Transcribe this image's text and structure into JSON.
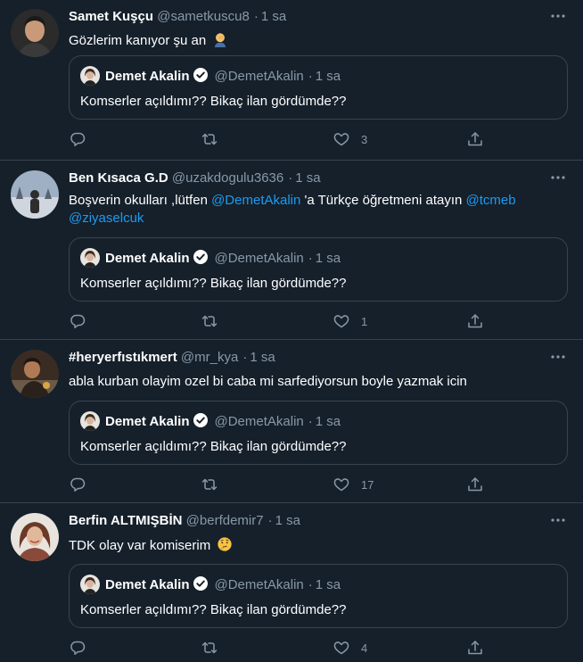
{
  "tweets": [
    {
      "name": "Samet Kuşçu",
      "handle": "@sametkuscu8",
      "time": "1 sa",
      "text_before": "Gözlerim kanıyor şu an",
      "emoji": "facepalm-emoji",
      "likes": "3",
      "quote": {
        "name": "Demet Akalin",
        "handle": "@DemetAkalin",
        "time": "1 sa",
        "text": "Komserler açıldımı?? Bikaç ilan gördümde??"
      }
    },
    {
      "name": "Ben Kısaca G.D",
      "handle": "@uzakdogulu3636",
      "time": "1 sa",
      "text_line1_a": "Boşverin okulları ,lütfen ",
      "mention1": "@DemetAkalin",
      "text_line1_b": " 'a Türkçe öğretmeni atayın ",
      "mention2": "@tcmeb",
      "mention3": "@ziyaselcuk",
      "likes": "1",
      "quote": {
        "name": "Demet Akalin",
        "handle": "@DemetAkalin",
        "time": "1 sa",
        "text": "Komserler açıldımı?? Bikaç ilan gördümde??"
      }
    },
    {
      "name": "#heryerfıstıkmert",
      "handle": "@mr_kya",
      "time": "1 sa",
      "text": "abla kurban olayim ozel bi caba mi sarfediyorsun boyle yazmak icin",
      "likes": "17",
      "quote": {
        "name": "Demet Akalin",
        "handle": "@DemetAkalin",
        "time": "1 sa",
        "text": "Komserler açıldımı?? Bikaç ilan gördümde??"
      }
    },
    {
      "name": "Berfin ALTMIŞBİN",
      "handle": "@berfdemir7",
      "time": "1 sa",
      "text_before": "TDK olay var komiserim",
      "emoji": "thinking-face-emoji",
      "likes": "4",
      "quote": {
        "name": "Demet Akalin",
        "handle": "@DemetAkalin",
        "time": "1 sa",
        "text": "Komserler açıldımı?? Bikaç ilan gördümde??"
      }
    }
  ],
  "icons": {
    "more": "more-icon",
    "reply": "reply-icon",
    "retweet": "retweet-icon",
    "like": "like-icon",
    "share": "share-icon",
    "verified": "verified-badge-icon"
  },
  "colors": {
    "background": "#15202b",
    "border": "#38444d",
    "secondary_text": "#8899a6",
    "mention": "#1d9bf0"
  }
}
